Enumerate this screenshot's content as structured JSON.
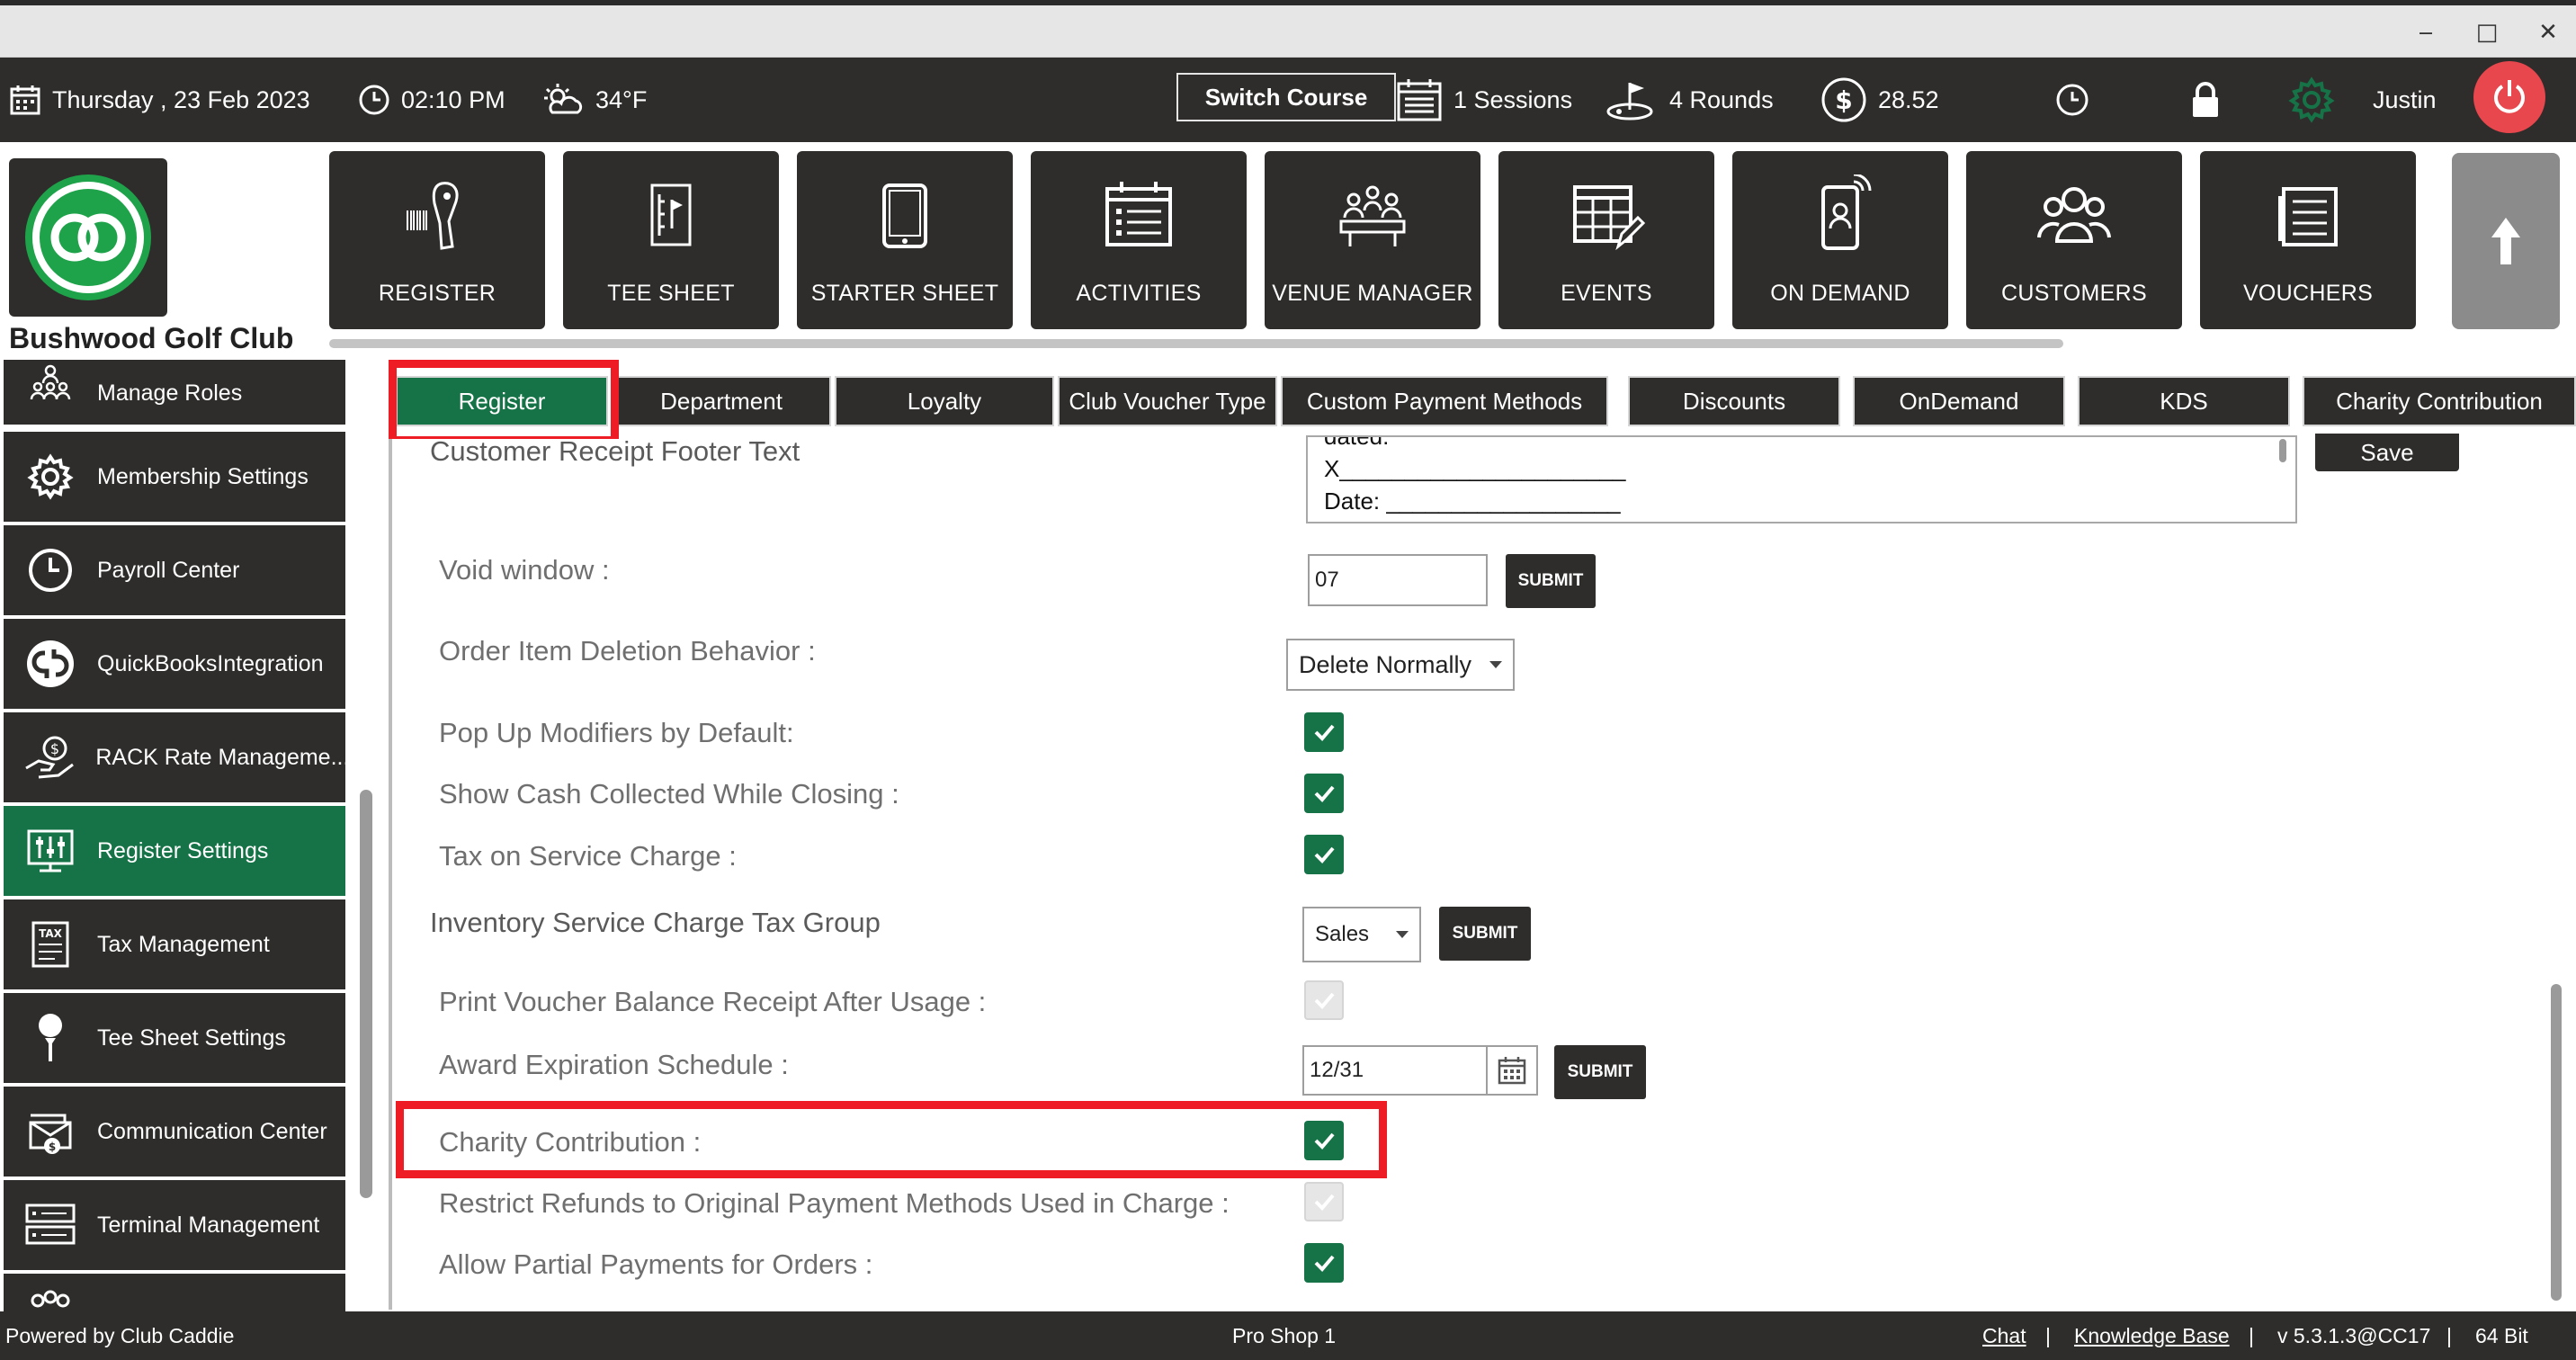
{
  "window": {
    "minimize": "‒",
    "maximize": "□",
    "close": "✕"
  },
  "topbar": {
    "date": "Thursday ,  23 Feb 2023",
    "time": "02:10 PM",
    "weather": "34°F",
    "switch_course": "Switch Course",
    "sessions": "1 Sessions",
    "rounds": "4 Rounds",
    "amount": "28.52",
    "user": "Justin"
  },
  "club_name": "Bushwood Golf Club",
  "nav": [
    {
      "label": "REGISTER",
      "icon": "barcode-scanner-icon"
    },
    {
      "label": "TEE SHEET",
      "icon": "tee-sheet-icon"
    },
    {
      "label": "STARTER SHEET",
      "icon": "tablet-icon"
    },
    {
      "label": "ACTIVITIES",
      "icon": "calendar-list-icon"
    },
    {
      "label": "VENUE MANAGER",
      "icon": "meeting-table-icon"
    },
    {
      "label": "EVENTS",
      "icon": "calendar-edit-icon"
    },
    {
      "label": "ON DEMAND",
      "icon": "phone-signal-icon"
    },
    {
      "label": "CUSTOMERS",
      "icon": "users-icon"
    },
    {
      "label": "VOUCHERS",
      "icon": "voucher-icon"
    }
  ],
  "sidebar": [
    {
      "label": "Manage Roles",
      "icon": "roles-icon"
    },
    {
      "label": "Membership Settings",
      "icon": "gear-icon"
    },
    {
      "label": "Payroll Center",
      "icon": "clock-icon"
    },
    {
      "label": "QuickBooksIntegration",
      "icon": "quickbooks-icon"
    },
    {
      "label": "RACK Rate Manageme...",
      "icon": "rate-hand-icon"
    },
    {
      "label": "Register Settings",
      "icon": "register-settings-icon",
      "active": true
    },
    {
      "label": "Tax Management",
      "icon": "tax-icon"
    },
    {
      "label": "Tee Sheet Settings",
      "icon": "golf-tee-icon"
    },
    {
      "label": "Communication Center",
      "icon": "communication-icon"
    },
    {
      "label": "Terminal Management",
      "icon": "terminal-icon"
    }
  ],
  "tabs": [
    {
      "label": "Register",
      "active": true
    },
    {
      "label": "Department"
    },
    {
      "label": "Loyalty"
    },
    {
      "label": "Club Voucher Type"
    },
    {
      "label": "Custom Payment Methods"
    },
    {
      "label": "Discounts"
    },
    {
      "label": "OnDemand"
    },
    {
      "label": "KDS"
    },
    {
      "label": "Charity Contribution"
    }
  ],
  "settings": {
    "footer_label": "Customer Receipt Footer Text",
    "footer_lines": [
      "dated:",
      "X______________________",
      "Date: __________________"
    ],
    "save": "Save",
    "void_window_label": "Void window :",
    "void_window_value": "07",
    "submit": "SUBMIT",
    "deletion_label": "Order Item Deletion Behavior :",
    "deletion_value": "Delete Normally",
    "popup_label": "Pop Up Modifiers by Default:",
    "cash_label": "Show Cash Collected While Closing :",
    "tax_service_label": "Tax on Service Charge :",
    "inventory_label": "Inventory Service Charge Tax Group",
    "inventory_value": "Sales",
    "voucher_label": "Print Voucher Balance Receipt After Usage :",
    "award_label": "Award Expiration Schedule :",
    "award_value": "12/31",
    "charity_label": "Charity Contribution  :",
    "refunds_label": "Restrict Refunds to Original Payment Methods Used in Charge :",
    "partial_label": "Allow Partial Payments for Orders :"
  },
  "statusbar": {
    "powered": "Powered by Club Caddie",
    "shop": "Pro Shop 1",
    "chat": "Chat",
    "sep": "|",
    "kb": "Knowledge Base",
    "version": "v 5.3.1.3@CC17",
    "bits": "64 Bit"
  },
  "colors": {
    "dark": "#2e2d2b",
    "green": "#157347",
    "highlight": "#ee1c24",
    "power": "#e8474d"
  }
}
